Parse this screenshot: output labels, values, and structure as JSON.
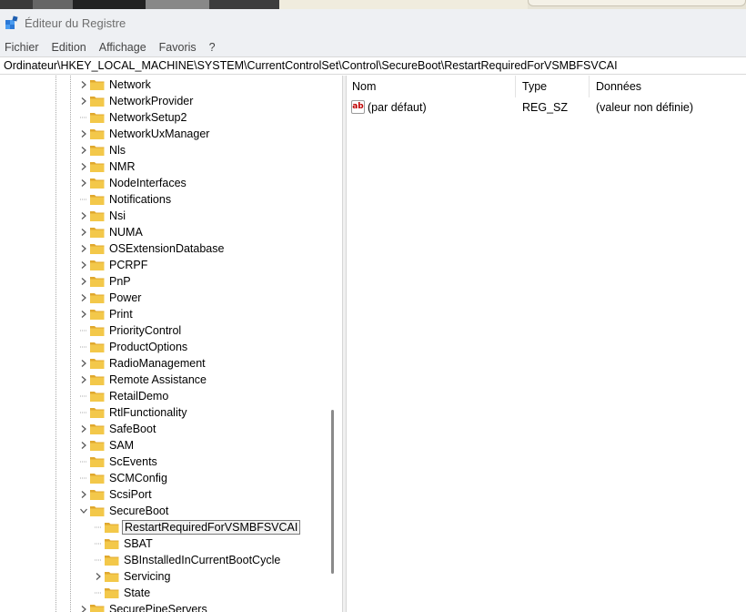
{
  "window": {
    "title": "Éditeur du Registre"
  },
  "menu": [
    "Fichier",
    "Edition",
    "Affichage",
    "Favoris",
    "?"
  ],
  "address": "Ordinateur\\HKEY_LOCAL_MACHINE\\SYSTEM\\CurrentControlSet\\Control\\SecureBoot\\RestartRequiredForVSMBFSVCAI",
  "tree": [
    {
      "label": "Network",
      "expander": "collapsed",
      "depth": 0
    },
    {
      "label": "NetworkProvider",
      "expander": "collapsed",
      "depth": 0
    },
    {
      "label": "NetworkSetup2",
      "expander": "none",
      "depth": 0
    },
    {
      "label": "NetworkUxManager",
      "expander": "collapsed",
      "depth": 0
    },
    {
      "label": "Nls",
      "expander": "collapsed",
      "depth": 0
    },
    {
      "label": "NMR",
      "expander": "collapsed",
      "depth": 0
    },
    {
      "label": "NodeInterfaces",
      "expander": "collapsed",
      "depth": 0
    },
    {
      "label": "Notifications",
      "expander": "none",
      "depth": 0
    },
    {
      "label": "Nsi",
      "expander": "collapsed",
      "depth": 0
    },
    {
      "label": "NUMA",
      "expander": "collapsed",
      "depth": 0
    },
    {
      "label": "OSExtensionDatabase",
      "expander": "collapsed",
      "depth": 0
    },
    {
      "label": "PCRPF",
      "expander": "collapsed",
      "depth": 0
    },
    {
      "label": "PnP",
      "expander": "collapsed",
      "depth": 0
    },
    {
      "label": "Power",
      "expander": "collapsed",
      "depth": 0
    },
    {
      "label": "Print",
      "expander": "collapsed",
      "depth": 0
    },
    {
      "label": "PriorityControl",
      "expander": "none",
      "depth": 0
    },
    {
      "label": "ProductOptions",
      "expander": "none",
      "depth": 0
    },
    {
      "label": "RadioManagement",
      "expander": "collapsed",
      "depth": 0
    },
    {
      "label": "Remote Assistance",
      "expander": "collapsed",
      "depth": 0
    },
    {
      "label": "RetailDemo",
      "expander": "none",
      "depth": 0
    },
    {
      "label": "RtlFunctionality",
      "expander": "none",
      "depth": 0
    },
    {
      "label": "SafeBoot",
      "expander": "collapsed",
      "depth": 0
    },
    {
      "label": "SAM",
      "expander": "collapsed",
      "depth": 0
    },
    {
      "label": "ScEvents",
      "expander": "none",
      "depth": 0
    },
    {
      "label": "SCMConfig",
      "expander": "none",
      "depth": 0
    },
    {
      "label": "ScsiPort",
      "expander": "collapsed",
      "depth": 0
    },
    {
      "label": "SecureBoot",
      "expander": "expanded",
      "depth": 0
    },
    {
      "label": "RestartRequiredForVSMBFSVCAI",
      "expander": "none",
      "depth": 1,
      "selected": true
    },
    {
      "label": "SBAT",
      "expander": "none",
      "depth": 1
    },
    {
      "label": "SBInstalledInCurrentBootCycle",
      "expander": "none",
      "depth": 1
    },
    {
      "label": "Servicing",
      "expander": "collapsed",
      "depth": 1
    },
    {
      "label": "State",
      "expander": "none",
      "depth": 1
    },
    {
      "label": "SecurePipeServers",
      "expander": "collapsed",
      "depth": 0
    }
  ],
  "list": {
    "columns": [
      "Nom",
      "Type",
      "Données"
    ],
    "rows": [
      {
        "icon": "string-value-icon",
        "icon_text": "ab",
        "name": "(par défaut)",
        "type": "REG_SZ",
        "data": "(valeur non définie)"
      }
    ]
  },
  "colors": {
    "folder": "#f3c84a",
    "folder_dark": "#e0a82e",
    "selection_border": "#7a7a7a"
  }
}
